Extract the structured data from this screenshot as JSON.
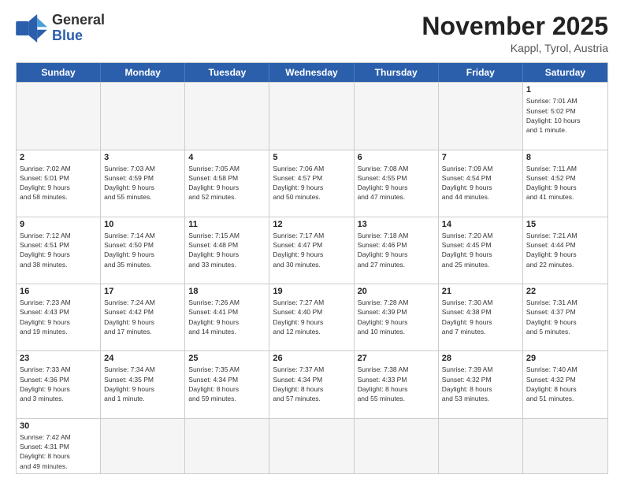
{
  "header": {
    "logo_general": "General",
    "logo_blue": "Blue",
    "title": "November 2025",
    "subtitle": "Kappl, Tyrol, Austria"
  },
  "days_of_week": [
    "Sunday",
    "Monday",
    "Tuesday",
    "Wednesday",
    "Thursday",
    "Friday",
    "Saturday"
  ],
  "weeks": [
    [
      {
        "day": "",
        "info": "",
        "empty": true
      },
      {
        "day": "",
        "info": "",
        "empty": true
      },
      {
        "day": "",
        "info": "",
        "empty": true
      },
      {
        "day": "",
        "info": "",
        "empty": true
      },
      {
        "day": "",
        "info": "",
        "empty": true
      },
      {
        "day": "",
        "info": "",
        "empty": true
      },
      {
        "day": "1",
        "info": "Sunrise: 7:01 AM\nSunset: 5:02 PM\nDaylight: 10 hours\nand 1 minute."
      }
    ],
    [
      {
        "day": "2",
        "info": "Sunrise: 7:02 AM\nSunset: 5:01 PM\nDaylight: 9 hours\nand 58 minutes."
      },
      {
        "day": "3",
        "info": "Sunrise: 7:03 AM\nSunset: 4:59 PM\nDaylight: 9 hours\nand 55 minutes."
      },
      {
        "day": "4",
        "info": "Sunrise: 7:05 AM\nSunset: 4:58 PM\nDaylight: 9 hours\nand 52 minutes."
      },
      {
        "day": "5",
        "info": "Sunrise: 7:06 AM\nSunset: 4:57 PM\nDaylight: 9 hours\nand 50 minutes."
      },
      {
        "day": "6",
        "info": "Sunrise: 7:08 AM\nSunset: 4:55 PM\nDaylight: 9 hours\nand 47 minutes."
      },
      {
        "day": "7",
        "info": "Sunrise: 7:09 AM\nSunset: 4:54 PM\nDaylight: 9 hours\nand 44 minutes."
      },
      {
        "day": "8",
        "info": "Sunrise: 7:11 AM\nSunset: 4:52 PM\nDaylight: 9 hours\nand 41 minutes."
      }
    ],
    [
      {
        "day": "9",
        "info": "Sunrise: 7:12 AM\nSunset: 4:51 PM\nDaylight: 9 hours\nand 38 minutes."
      },
      {
        "day": "10",
        "info": "Sunrise: 7:14 AM\nSunset: 4:50 PM\nDaylight: 9 hours\nand 35 minutes."
      },
      {
        "day": "11",
        "info": "Sunrise: 7:15 AM\nSunset: 4:48 PM\nDaylight: 9 hours\nand 33 minutes."
      },
      {
        "day": "12",
        "info": "Sunrise: 7:17 AM\nSunset: 4:47 PM\nDaylight: 9 hours\nand 30 minutes."
      },
      {
        "day": "13",
        "info": "Sunrise: 7:18 AM\nSunset: 4:46 PM\nDaylight: 9 hours\nand 27 minutes."
      },
      {
        "day": "14",
        "info": "Sunrise: 7:20 AM\nSunset: 4:45 PM\nDaylight: 9 hours\nand 25 minutes."
      },
      {
        "day": "15",
        "info": "Sunrise: 7:21 AM\nSunset: 4:44 PM\nDaylight: 9 hours\nand 22 minutes."
      }
    ],
    [
      {
        "day": "16",
        "info": "Sunrise: 7:23 AM\nSunset: 4:43 PM\nDaylight: 9 hours\nand 19 minutes."
      },
      {
        "day": "17",
        "info": "Sunrise: 7:24 AM\nSunset: 4:42 PM\nDaylight: 9 hours\nand 17 minutes."
      },
      {
        "day": "18",
        "info": "Sunrise: 7:26 AM\nSunset: 4:41 PM\nDaylight: 9 hours\nand 14 minutes."
      },
      {
        "day": "19",
        "info": "Sunrise: 7:27 AM\nSunset: 4:40 PM\nDaylight: 9 hours\nand 12 minutes."
      },
      {
        "day": "20",
        "info": "Sunrise: 7:28 AM\nSunset: 4:39 PM\nDaylight: 9 hours\nand 10 minutes."
      },
      {
        "day": "21",
        "info": "Sunrise: 7:30 AM\nSunset: 4:38 PM\nDaylight: 9 hours\nand 7 minutes."
      },
      {
        "day": "22",
        "info": "Sunrise: 7:31 AM\nSunset: 4:37 PM\nDaylight: 9 hours\nand 5 minutes."
      }
    ],
    [
      {
        "day": "23",
        "info": "Sunrise: 7:33 AM\nSunset: 4:36 PM\nDaylight: 9 hours\nand 3 minutes."
      },
      {
        "day": "24",
        "info": "Sunrise: 7:34 AM\nSunset: 4:35 PM\nDaylight: 9 hours\nand 1 minute."
      },
      {
        "day": "25",
        "info": "Sunrise: 7:35 AM\nSunset: 4:34 PM\nDaylight: 8 hours\nand 59 minutes."
      },
      {
        "day": "26",
        "info": "Sunrise: 7:37 AM\nSunset: 4:34 PM\nDaylight: 8 hours\nand 57 minutes."
      },
      {
        "day": "27",
        "info": "Sunrise: 7:38 AM\nSunset: 4:33 PM\nDaylight: 8 hours\nand 55 minutes."
      },
      {
        "day": "28",
        "info": "Sunrise: 7:39 AM\nSunset: 4:32 PM\nDaylight: 8 hours\nand 53 minutes."
      },
      {
        "day": "29",
        "info": "Sunrise: 7:40 AM\nSunset: 4:32 PM\nDaylight: 8 hours\nand 51 minutes."
      }
    ],
    [
      {
        "day": "30",
        "info": "Sunrise: 7:42 AM\nSunset: 4:31 PM\nDaylight: 8 hours\nand 49 minutes."
      },
      {
        "day": "",
        "info": "",
        "empty": true
      },
      {
        "day": "",
        "info": "",
        "empty": true
      },
      {
        "day": "",
        "info": "",
        "empty": true
      },
      {
        "day": "",
        "info": "",
        "empty": true
      },
      {
        "day": "",
        "info": "",
        "empty": true
      },
      {
        "day": "",
        "info": "",
        "empty": true
      }
    ]
  ]
}
